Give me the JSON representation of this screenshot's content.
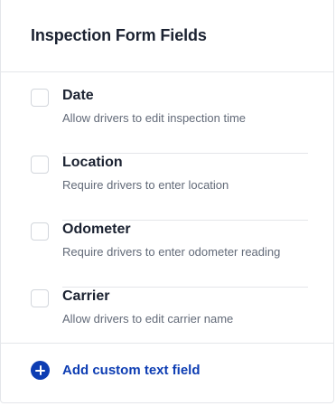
{
  "header": {
    "title": "Inspection Form Fields"
  },
  "fields": [
    {
      "label": "Date",
      "description": "Allow drivers to edit inspection time",
      "checked": false
    },
    {
      "label": "Location",
      "description": "Require drivers to enter location",
      "checked": false
    },
    {
      "label": "Odometer",
      "description": "Require drivers to enter odometer reading",
      "checked": false
    },
    {
      "label": "Carrier",
      "description": "Allow drivers to edit carrier name",
      "checked": false
    }
  ],
  "footer": {
    "add_label": "Add custom text field",
    "add_icon": "plus-circle-icon"
  },
  "colors": {
    "accent": "#0d3db3",
    "title": "#1b2231",
    "muted": "#626a78",
    "border": "#e4e6ea"
  }
}
